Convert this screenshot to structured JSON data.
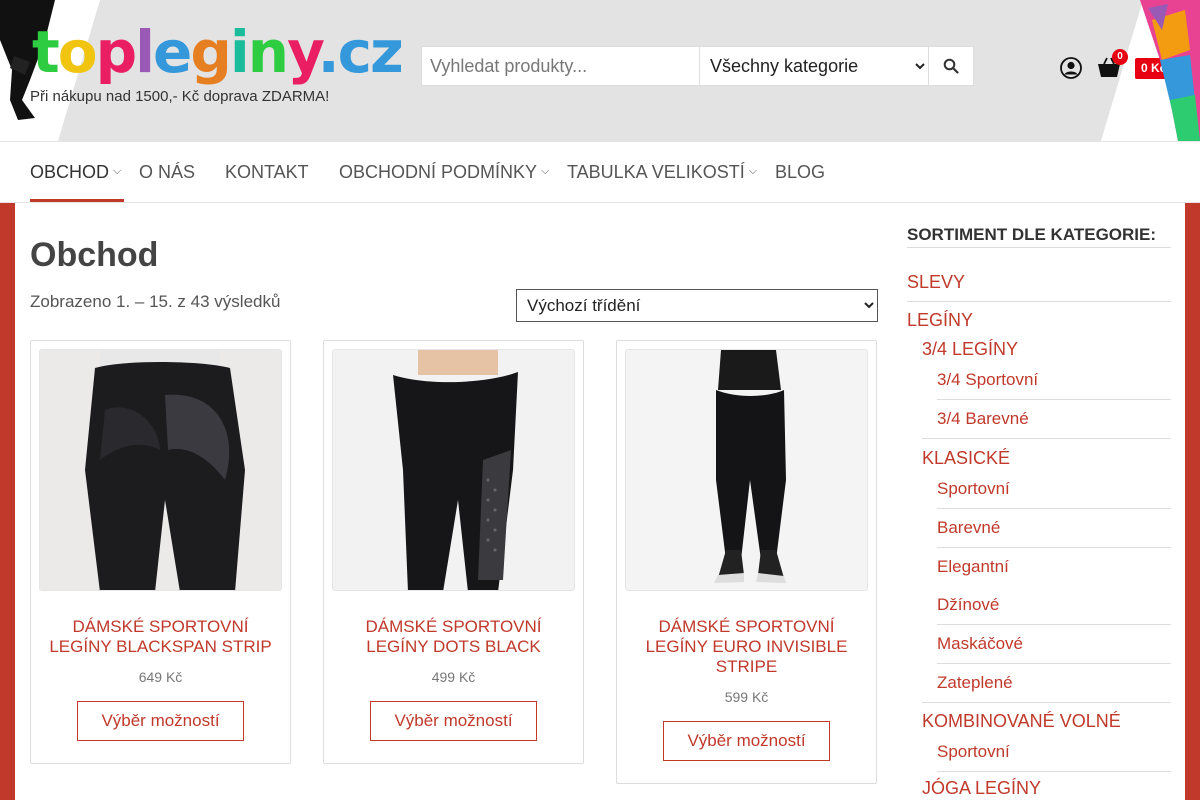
{
  "header": {
    "logo_text": "topleginy.cz",
    "tagline": "Při nákupu nad 1500,- Kč doprava ZDARMA!",
    "search": {
      "placeholder": "Vyhledat produkty...",
      "category_selected": "Všechny kategorie",
      "button_icon": "search-icon"
    },
    "cart": {
      "count": "0",
      "total": "0 Kč"
    }
  },
  "nav": {
    "items": [
      {
        "label": "OBCHOD",
        "dropdown": true
      },
      {
        "label": "O NÁS",
        "dropdown": false
      },
      {
        "label": "KONTAKT",
        "dropdown": false
      },
      {
        "label": "OBCHODNÍ PODMÍNKY",
        "dropdown": true
      },
      {
        "label": "TABULKA VELIKOSTÍ",
        "dropdown": true
      },
      {
        "label": "BLOG",
        "dropdown": false
      }
    ]
  },
  "main": {
    "title": "Obchod",
    "result_count": "Zobrazeno 1. – 15. z 43 výsledků",
    "sort_selected": "Výchozí třídění",
    "products": [
      {
        "name": "DÁMSKÉ SPORTOVNÍ LEGÍNY BLACKSPAN STRIP",
        "price": "649 Kč",
        "button": "Výběr možností"
      },
      {
        "name": "DÁMSKÉ SPORTOVNÍ LEGÍNY DOTS BLACK",
        "price": "499 Kč",
        "button": "Výběr možností"
      },
      {
        "name": "DÁMSKÉ SPORTOVNÍ LEGÍNY EURO INVISIBLE STRIPE",
        "price": "599 Kč",
        "button": "Výběr možností"
      }
    ]
  },
  "sidebar": {
    "heading": "SORTIMENT DLE KATEGORIE:",
    "categories": {
      "slevy": "SLEVY",
      "leginy": "LEGÍNY",
      "tri_ctvrte": "3/4 LEGÍNY",
      "tri_ctvrte_sport": "3/4 Sportovní",
      "tri_ctvrte_barevne": "3/4 Barevné",
      "klasicke": "KLASICKÉ",
      "klasicke_items": [
        "Sportovní",
        "Barevné",
        "Elegantní",
        "Džínové",
        "Maskáčové",
        "Zateplené"
      ],
      "kombinovane": "KOMBINOVANÉ VOLNÉ",
      "kombinovane_sport": "Sportovní",
      "joga": "JÓGA LEGÍNY"
    }
  },
  "colors": {
    "accent": "#c0392b",
    "badge": "#e60012",
    "header_band": "#e3e3e3"
  }
}
